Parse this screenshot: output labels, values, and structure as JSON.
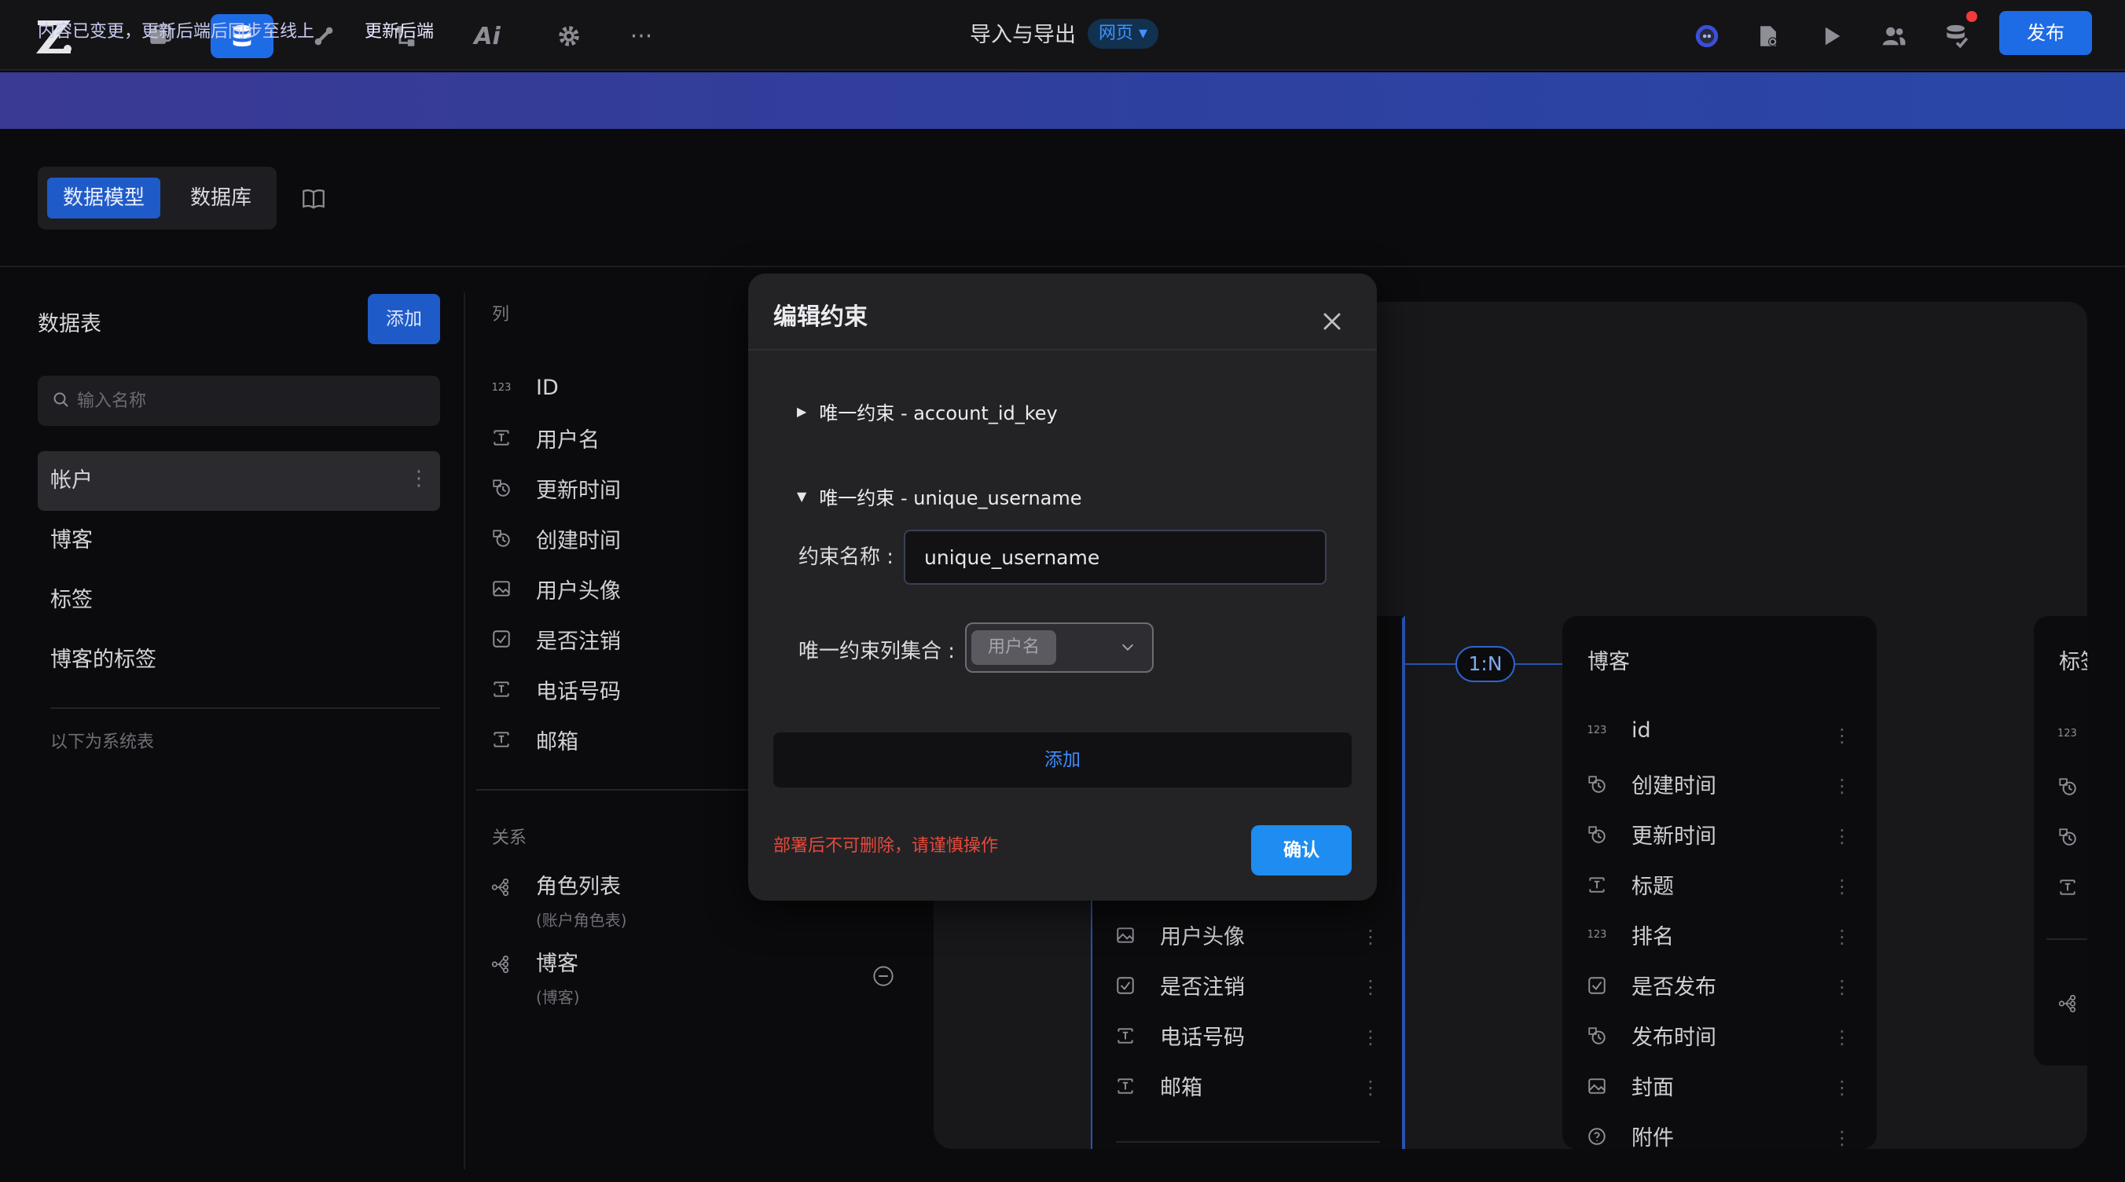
{
  "topbar": {
    "title": "导入与导出",
    "env": "网页 ▾",
    "publish": "发布",
    "more": "···",
    "ai": "Ai"
  },
  "banner": {
    "message": "内容已变更，更新后端后同步至线上",
    "action": "更新后端"
  },
  "subheader": {
    "tab_model": "数据模型",
    "tab_db": "数据库"
  },
  "sidebar": {
    "title": "数据表",
    "add": "添加",
    "search_placeholder": "输入名称",
    "items": [
      "帐户",
      "博客",
      "标签",
      "博客的标签"
    ],
    "system_label": "以下为系统表"
  },
  "columns": {
    "title": "列",
    "items": [
      "ID",
      "用户名",
      "更新时间",
      "创建时间",
      "用户头像",
      "是否注销",
      "电话号码",
      "邮箱"
    ],
    "relations_title": "关系",
    "relations": [
      {
        "name": "角色列表",
        "sub": "(账户角色表)"
      },
      {
        "name": "博客",
        "sub": "(博客)"
      }
    ]
  },
  "canvas": {
    "account_rows": [
      "用户头像",
      "是否注销",
      "电话号码",
      "邮箱"
    ],
    "link_label": "1:N",
    "blog_title": "博客",
    "blog_rows": [
      "id",
      "创建时间",
      "更新时间",
      "标题",
      "排名",
      "是否发布",
      "发布时间",
      "封面",
      "附件"
    ],
    "tag_title": "标签"
  },
  "modal": {
    "title": "编辑约束",
    "constraint_1": "唯一约束 - account_id_key",
    "constraint_2": "唯一约束 - unique_username",
    "name_label": "约束名称 :",
    "name_value": "unique_username",
    "cols_label": "唯一约束列集合 :",
    "selected_col": "用户名",
    "add": "添加",
    "warning": "部署后不可删除，请谨慎操作",
    "confirm": "确认"
  },
  "icons": {
    "number": "123",
    "kebab": "⋮"
  },
  "colors": {
    "accent": "#1e6be6",
    "warning": "#e64a3c",
    "banner": "#3a3993"
  }
}
